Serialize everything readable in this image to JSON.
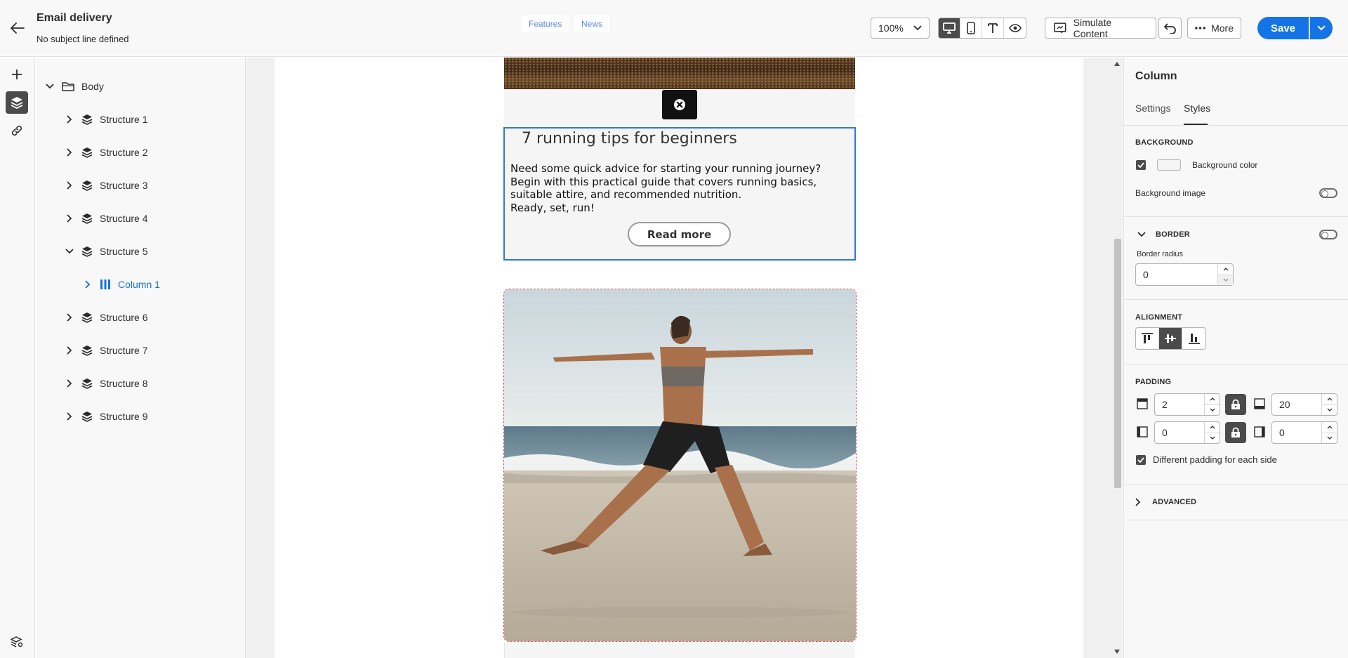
{
  "header": {
    "title": "Email delivery",
    "subtitle": "No subject line defined",
    "zoom": "100%",
    "simulate_label": "Simulate Content",
    "more_label": "More",
    "save_label": "Save"
  },
  "tree": {
    "root": "Body",
    "items": [
      {
        "label": "Structure 1"
      },
      {
        "label": "Structure 2"
      },
      {
        "label": "Structure 3"
      },
      {
        "label": "Structure 4"
      },
      {
        "label": "Structure 5"
      },
      {
        "label": "Column 1"
      },
      {
        "label": "Structure 6"
      },
      {
        "label": "Structure 7"
      },
      {
        "label": "Structure 8"
      },
      {
        "label": "Structure 9"
      }
    ]
  },
  "canvas": {
    "tags": [
      "Features",
      "News"
    ],
    "article_title": "7 running tips for beginners",
    "article_body": [
      "Need some quick advice for starting your running journey?",
      "Begin with this practical guide that covers running basics, suitable attire, and recommended nutrition.",
      "Ready, set, run!"
    ],
    "cta_label": "Read more"
  },
  "props": {
    "title": "Column",
    "tabs": [
      "Settings",
      "Styles"
    ],
    "active_tab": "Styles",
    "background": {
      "section_label": "BACKGROUND",
      "color_label": "Background color",
      "color_checked": true,
      "image_label": "Background image",
      "image_enabled": false
    },
    "border": {
      "section_label": "BORDER",
      "enabled": false,
      "radius_label": "Border radius",
      "radius_value": "0"
    },
    "alignment": {
      "section_label": "ALIGNMENT",
      "selected": "middle"
    },
    "padding": {
      "section_label": "PADDING",
      "top": "2",
      "bottom": "20",
      "left": "0",
      "right": "0",
      "different_label": "Different padding for each side",
      "different_checked": true
    },
    "advanced_label": "ADVANCED"
  },
  "colors": {
    "accent": "#1473e6",
    "selection_border": "#2f78d9",
    "dark_active": "#4b4b4b"
  }
}
